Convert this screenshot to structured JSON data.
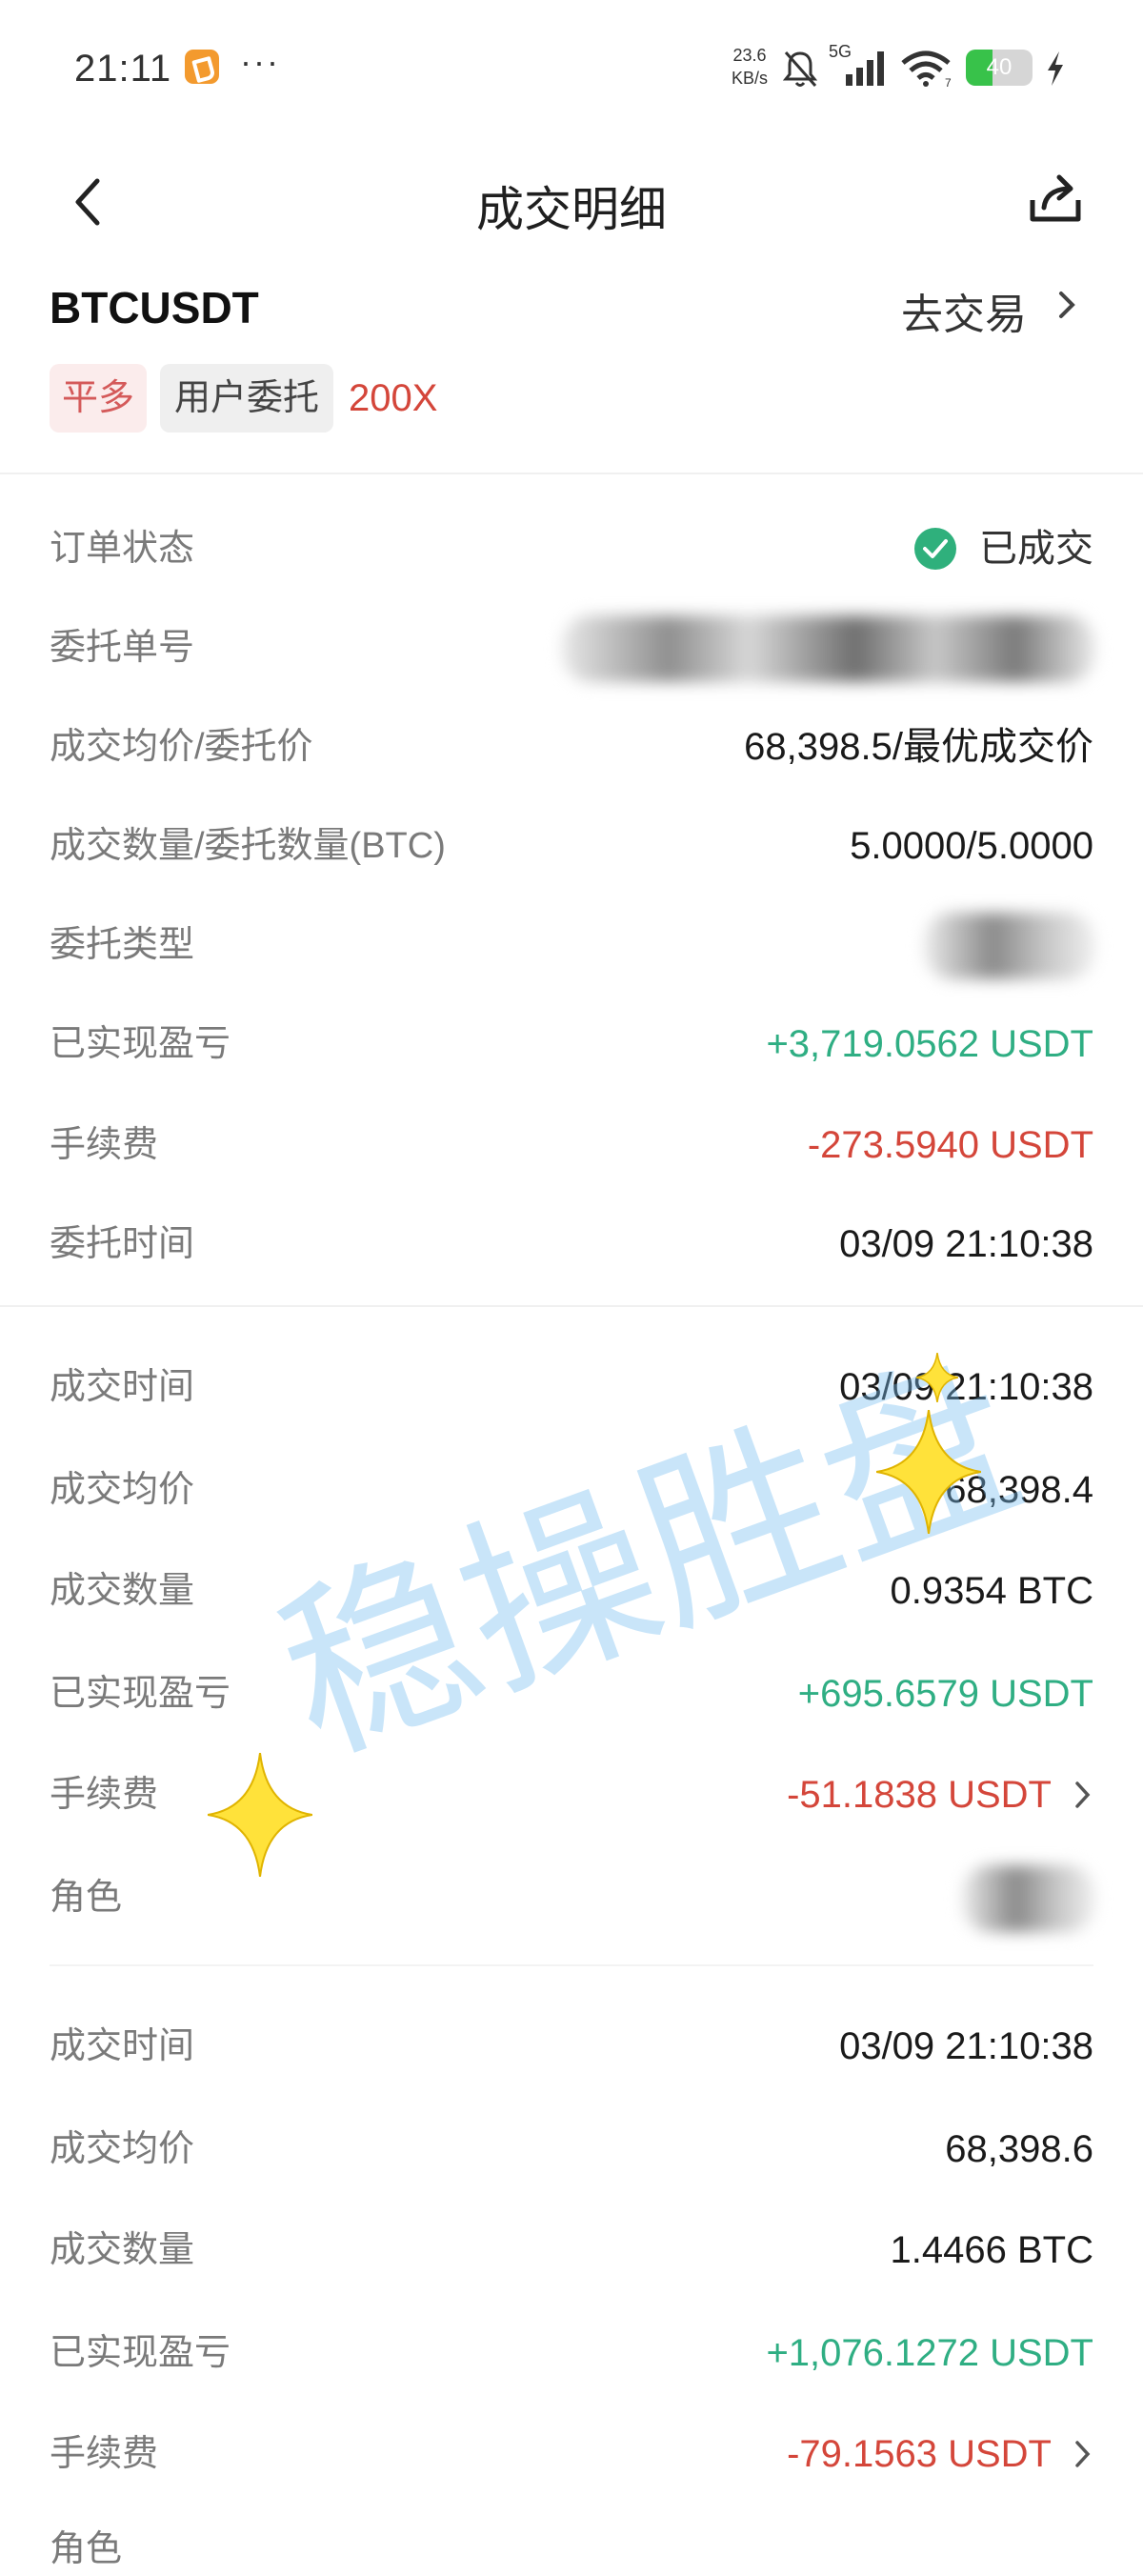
{
  "status_bar": {
    "time": "21:11",
    "more": "···",
    "net_speed": "23.6",
    "net_unit": "KB/s",
    "network": "5G",
    "wifi_badge": "7",
    "battery": "40",
    "battery_level": 0.4
  },
  "header": {
    "title": "成交明细",
    "icons": [
      "back-icon",
      "share-icon"
    ]
  },
  "instrument": {
    "symbol": "BTCUSDT",
    "trade_link": "去交易",
    "direction_tag": "平多",
    "source_tag": "用户委托",
    "leverage": "200X"
  },
  "order": {
    "status_label": "订单状态",
    "status_value": "已成交",
    "id_label": "委托单号",
    "price_label": "成交均价/委托价",
    "price_value": "68,398.5/最优成交价",
    "qty_label": "成交数量/委托数量(BTC)",
    "qty_value": "5.0000/5.0000",
    "type_label": "委托类型",
    "pnl_label": "已实现盈亏",
    "pnl_value": "+3,719.0562 USDT",
    "fee_label": "手续费",
    "fee_value": "-273.5940 USDT",
    "time_label": "委托时间",
    "time_value": "03/09 21:10:38"
  },
  "fills": [
    {
      "time_label": "成交时间",
      "time_value": "03/09 21:10:38",
      "price_label": "成交均价",
      "price_value": "68,398.4",
      "qty_label": "成交数量",
      "qty_value": "0.9354 BTC",
      "pnl_label": "已实现盈亏",
      "pnl_value": "+695.6579 USDT",
      "fee_label": "手续费",
      "fee_value": "-51.1838 USDT",
      "role_label": "角色"
    },
    {
      "time_label": "成交时间",
      "time_value": "03/09 21:10:38",
      "price_label": "成交均价",
      "price_value": "68,398.6",
      "qty_label": "成交数量",
      "qty_value": "1.4466 BTC",
      "pnl_label": "已实现盈亏",
      "pnl_value": "+1,076.1272 USDT",
      "fee_label": "手续费",
      "fee_value": "-79.1563 USDT",
      "role_label": "角色"
    }
  ],
  "watermark": "稳操胜盘",
  "colors": {
    "profit": "#2fae83",
    "loss": "#d4463a",
    "label": "#7a7a7a",
    "tag_direction_bg": "#fbecec"
  }
}
